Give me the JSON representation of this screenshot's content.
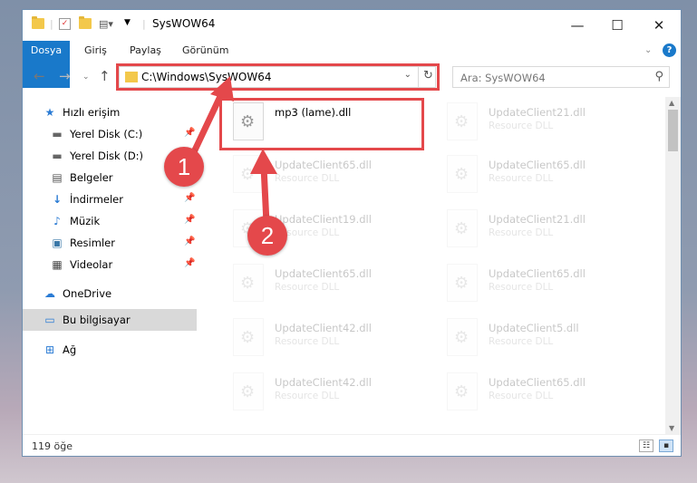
{
  "window": {
    "title": "SysWOW64",
    "controls": {
      "minimize": "—",
      "maximize": "☐",
      "close": "✕"
    }
  },
  "ribbon": {
    "tabs": [
      "Dosya",
      "Giriş",
      "Paylaş",
      "Görünüm"
    ],
    "collapse_icon": "chevron-down-icon",
    "help_icon": "?"
  },
  "navigation": {
    "address": "C:\\Windows\\SysWOW64",
    "search_placeholder": "Ara: SysWOW64"
  },
  "sidebar": {
    "items": [
      {
        "label": "Hızlı erişim",
        "icon": "★"
      },
      {
        "label": "Yerel Disk (C:)",
        "icon": "▬",
        "pinned": true
      },
      {
        "label": "Yerel Disk (D:)",
        "icon": "▬",
        "pinned": true
      },
      {
        "label": "Belgeler",
        "icon": "▤",
        "pinned": true
      },
      {
        "label": "İndirmeler",
        "icon": "↓",
        "pinned": true
      },
      {
        "label": "Müzik",
        "icon": "♪",
        "pinned": true
      },
      {
        "label": "Resimler",
        "icon": "▣",
        "pinned": true
      },
      {
        "label": "Videolar",
        "icon": "▦",
        "pinned": true
      },
      {
        "label": "OneDrive",
        "icon": "☁"
      },
      {
        "label": "Bu bilgisayar",
        "icon": "▭",
        "selected": true
      },
      {
        "label": "Ağ",
        "icon": "⊞"
      }
    ]
  },
  "files": {
    "highlighted": {
      "name": "mp3 (lame).dll",
      "type": ""
    },
    "faded": [
      {
        "name": "UpdateClient21.dll",
        "type": "Resource DLL"
      },
      {
        "name": "UpdateClient65.dll",
        "type": "Resource DLL"
      },
      {
        "name": "UpdateClient65.dll",
        "type": "Resource DLL"
      },
      {
        "name": "UpdateClient19.dll",
        "type": "Resource DLL"
      },
      {
        "name": "UpdateClient21.dll",
        "type": "Resource DLL"
      },
      {
        "name": "UpdateClient65.dll",
        "type": "Resource DLL"
      },
      {
        "name": "UpdateClient65.dll",
        "type": "Resource DLL"
      },
      {
        "name": "UpdateClient42.dll",
        "type": "Resource DLL"
      },
      {
        "name": "UpdateClient5.dll",
        "type": "Resource DLL"
      },
      {
        "name": "UpdateClient42.dll",
        "type": "Resource DLL"
      },
      {
        "name": "UpdateClient65.dll",
        "type": "Resource DLL"
      }
    ]
  },
  "status": {
    "item_count": "119 öğe"
  },
  "callouts": {
    "one": "1",
    "two": "2"
  },
  "colors": {
    "accent": "#1979ca",
    "highlight": "#e4484b"
  }
}
